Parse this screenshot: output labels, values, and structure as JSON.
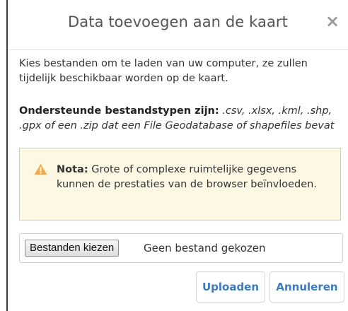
{
  "dialog": {
    "title": "Data toevoegen aan de kaart",
    "close_label": "×",
    "intro_text": "Kies bestanden om te laden van uw computer, ze zullen tijdelijk beschikbaar worden op de kaart.",
    "types_label": "Ondersteunde bestandstypen zijn:",
    "types_list": ".csv, .xlsx, .kml, .shp, .gpx of een .zip dat een File Geodatabase of shapefiles bevat",
    "alert": {
      "icon": "warning-icon",
      "label": "Nota:",
      "text": "Grote of complexe ruimtelijke gegevens kunnen de prestaties van de browser beïnvloeden."
    },
    "file_input": {
      "button_label": "Bestanden kiezen",
      "status": "Geen bestand gekozen"
    },
    "buttons": {
      "upload": "Uploaden",
      "cancel": "Annuleren"
    }
  },
  "colors": {
    "accent": "#3b7bbf",
    "warning_bg": "#fcf8e3",
    "warning_border": "#d9cf99",
    "warning_icon": "#f0ad4e"
  }
}
